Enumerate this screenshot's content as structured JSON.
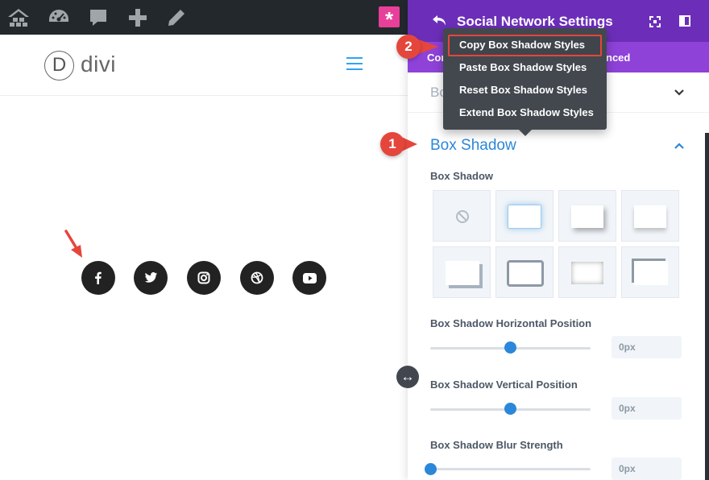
{
  "site": {
    "logo_letter": "D",
    "logo_text": "divi",
    "social_icons": [
      {
        "name": "facebook-icon",
        "glyph": "f"
      },
      {
        "name": "twitter-icon",
        "glyph": "twitter"
      },
      {
        "name": "instagram-icon",
        "glyph": "instagram"
      },
      {
        "name": "dribbble-icon",
        "glyph": "dribbble"
      },
      {
        "name": "youtube-icon",
        "glyph": "youtube"
      }
    ]
  },
  "adminbar": {
    "icons": [
      "wordpress-multisite-icon",
      "dashboard-gauge-icon",
      "comment-icon",
      "plus-icon",
      "pencil-icon",
      "asterisk-icon"
    ],
    "asterisk": "*"
  },
  "panel": {
    "title": "Social Network Settings",
    "tabs": [
      "Con",
      "nced"
    ],
    "closed_section_label": "Bo",
    "section_title": "Box Shadow",
    "box_shadow_label": "Box Shadow",
    "fields": [
      {
        "label": "Box Shadow Horizontal Position",
        "value": "0px",
        "slider_level": 0.5
      },
      {
        "label": "Box Shadow Vertical Position",
        "value": "0px",
        "slider_level": 0.5
      },
      {
        "label": "Box Shadow Blur Strength",
        "value": "0px",
        "slider_level": 0.0
      }
    ]
  },
  "menu": {
    "items": [
      "Copy Box Shadow Styles",
      "Paste Box Shadow Styles",
      "Reset Box Shadow Styles",
      "Extend Box Shadow Styles"
    ]
  },
  "markers": [
    "1",
    "2"
  ],
  "colors": {
    "panel_header": "#6c2eb9",
    "panel_tabs": "#8e42d8",
    "accent_blue": "#2b87da",
    "marker_red": "#e5463c",
    "menu_bg": "#43484f"
  }
}
